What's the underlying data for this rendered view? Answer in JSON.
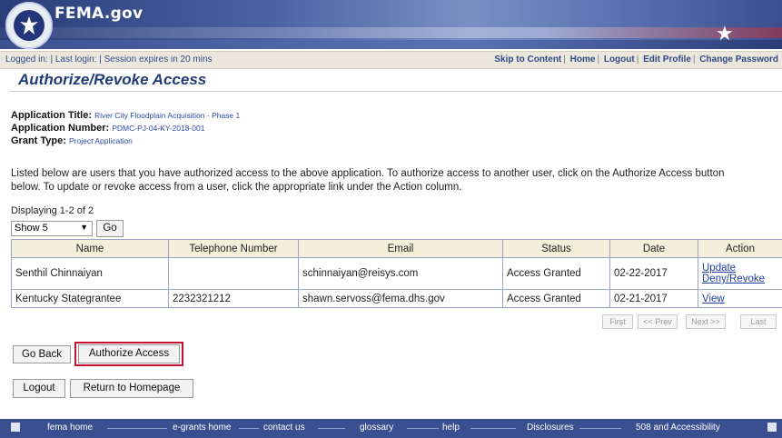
{
  "header": {
    "site_name": "FEMA.gov"
  },
  "topbar": {
    "login_info": "Logged in:  |  Last login:   |  Session expires in 20 mins",
    "links": [
      "Skip to Content",
      "Home",
      "Logout",
      "Edit Profile",
      "Change Password"
    ]
  },
  "page": {
    "title": "Authorize/Revoke Access",
    "app_title_label": "Application Title:",
    "app_title_value": "River City Floodplain Acquisition - Phase 1",
    "app_number_label": "Application Number:",
    "app_number_value": "PDMC-PJ-04-KY-2018-001",
    "grant_type_label": "Grant Type:",
    "grant_type_value": "Project Application",
    "description": "Listed below are users that you have authorized access to the above application. To authorize access to another user, click on the Authorize Access button below. To update or revoke access from a user, click the appropriate link under the Action column."
  },
  "listing": {
    "displaying": "Displaying 1-2 of 2",
    "show_value": "Show 5",
    "go_label": "Go",
    "columns": [
      "Name",
      "Telephone Number",
      "Email",
      "Status",
      "Date",
      "Action"
    ],
    "rows": [
      {
        "name": "Senthil Chinnaiyan",
        "phone": "",
        "email": "schinnaiyan@reisys.com",
        "status": "Access Granted",
        "date": "02-22-2017",
        "action1": "Update",
        "action2": "Deny/Revoke"
      },
      {
        "name": "Kentucky Stategrantee",
        "phone": "2232321212",
        "email": "shawn.servoss@fema.dhs.gov",
        "status": "Access Granted",
        "date": "02-21-2017",
        "action1": "View",
        "action2": ""
      }
    ],
    "pager": [
      "First",
      "<< Prev",
      "Next >>",
      "Last"
    ]
  },
  "buttons": {
    "go_back": "Go Back",
    "authorize_access": "Authorize Access",
    "logout": "Logout",
    "return_home": "Return to Homepage"
  },
  "footer": {
    "links": [
      "fema home",
      "e-grants home",
      "contact us",
      "glossary",
      "help",
      "Disclosures",
      "508 and Accessibility"
    ]
  },
  "colors": {
    "accent": "#1f3c78",
    "highlight": "#c8102e",
    "header_bg": "#f4efd8"
  }
}
